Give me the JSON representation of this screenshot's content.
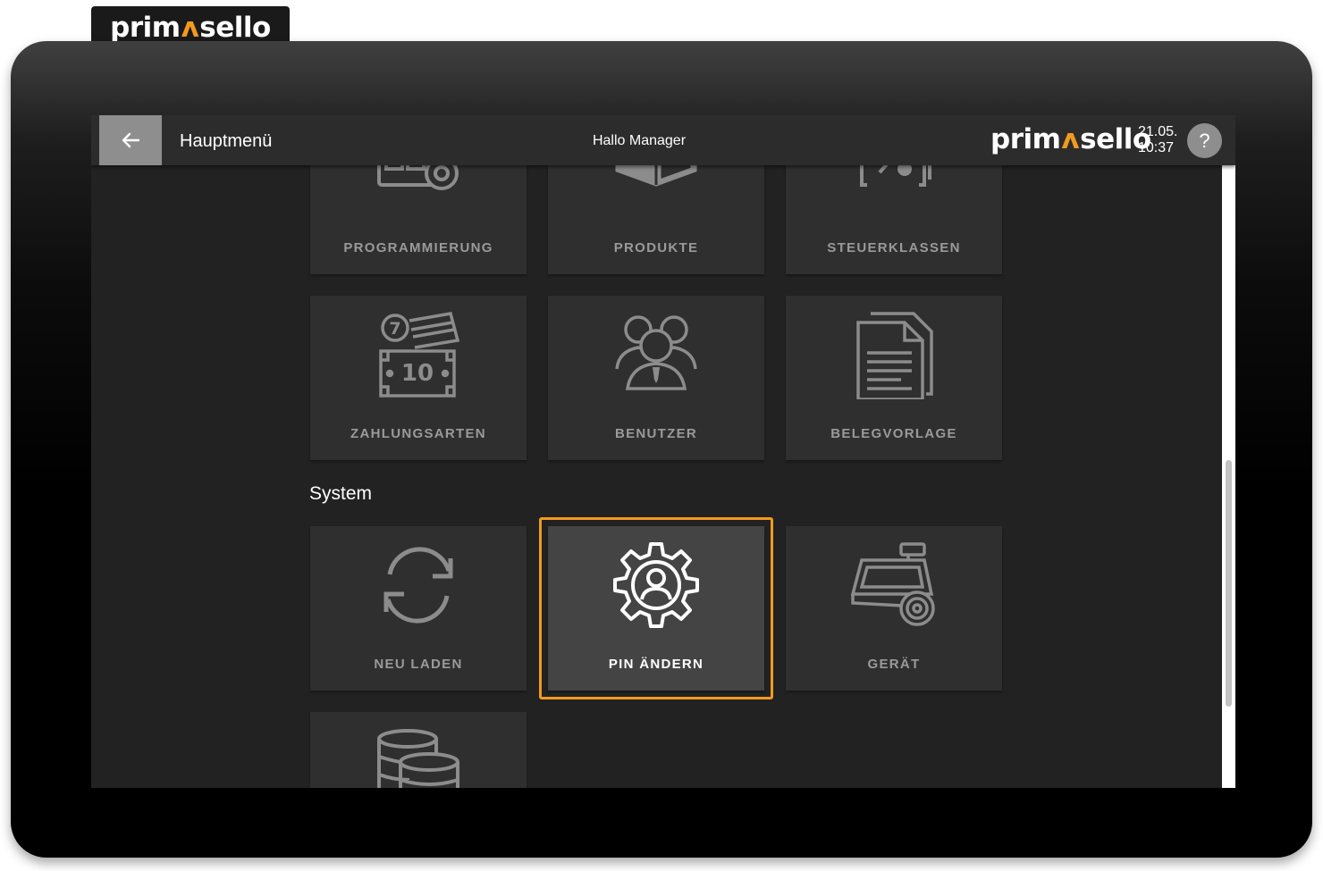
{
  "brand": {
    "part1": "prim",
    "mark": "ʌ",
    "part2": "sello",
    "accent_color": "#f29a1f"
  },
  "topbar": {
    "back_icon": "arrow-left-icon",
    "title": "Hauptmenü",
    "greeting": "Hallo Manager",
    "date": "21.05.",
    "time": "10:37",
    "help_label": "?"
  },
  "tiles_top": [
    {
      "label": "PROGRAMMIERUNG",
      "icon": "programming-grid-gear-icon"
    },
    {
      "label": "PRODUKTE",
      "icon": "open-box-icon"
    },
    {
      "label": "STEUERKLASSEN",
      "icon": "percent-document-icon"
    },
    {
      "label": "ZAHLUNGSARTEN",
      "icon": "cash-card-coin-icon"
    },
    {
      "label": "BENUTZER",
      "icon": "users-group-icon"
    },
    {
      "label": "BELEGVORLAGE",
      "icon": "documents-icon"
    }
  ],
  "system": {
    "title": "System",
    "tiles": [
      {
        "label": "NEU LADEN",
        "icon": "refresh-icon"
      },
      {
        "label": "PIN ÄNDERN",
        "icon": "user-gear-icon",
        "selected": true
      },
      {
        "label": "GERÄT",
        "icon": "register-gear-icon"
      },
      {
        "label": "",
        "icon": "database-icon"
      }
    ]
  },
  "colors": {
    "focus": "#f29a1f",
    "tile": "#2f2f2f",
    "tile_selected": "#444444",
    "background": "#222222"
  }
}
